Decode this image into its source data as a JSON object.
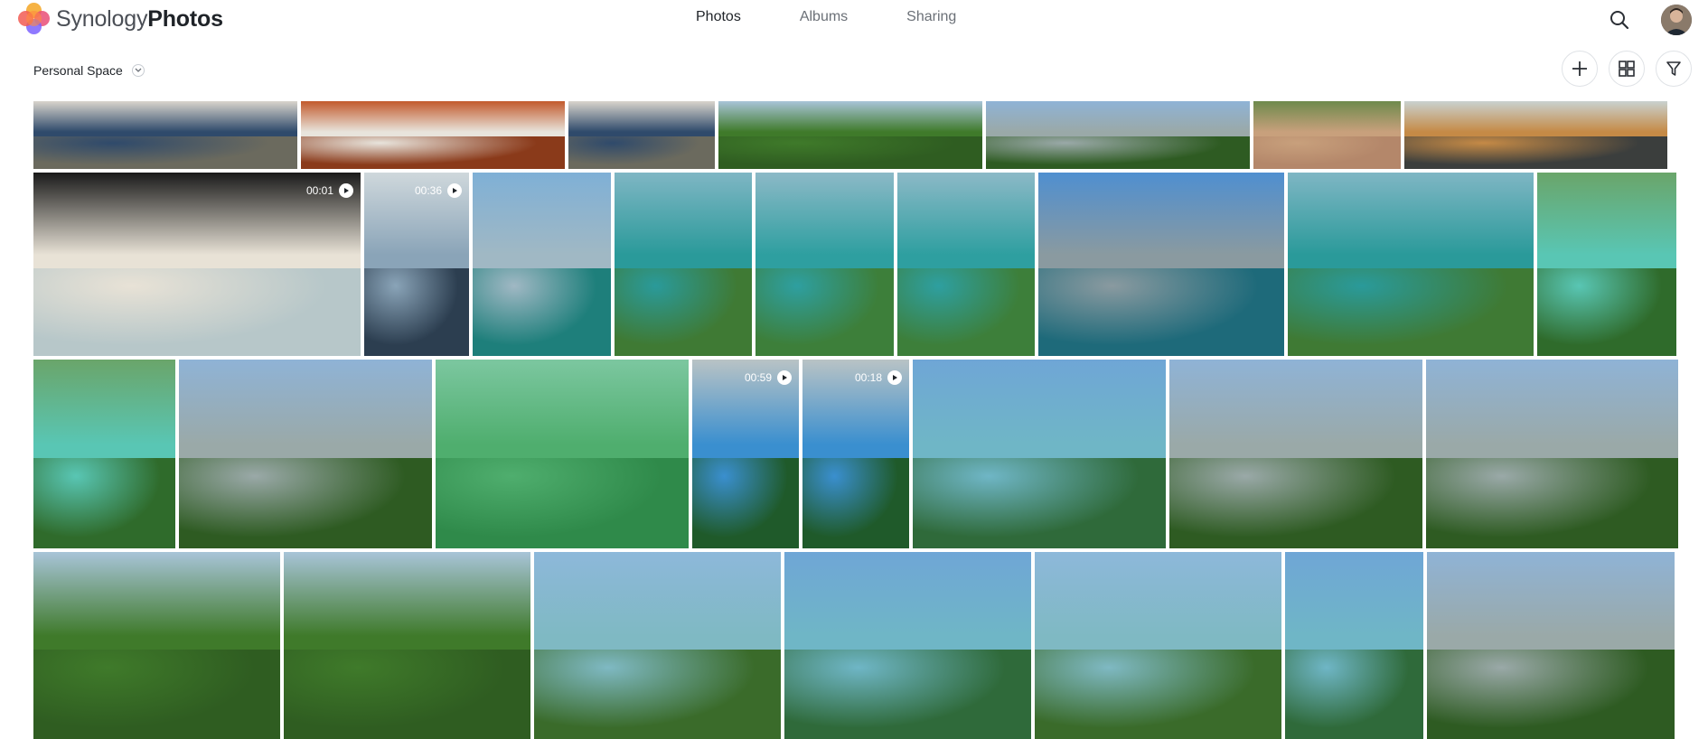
{
  "brand": {
    "light": "Synology",
    "bold": "Photos"
  },
  "nav": {
    "tabs": [
      {
        "label": "Photos",
        "active": true
      },
      {
        "label": "Albums",
        "active": false
      },
      {
        "label": "Sharing",
        "active": false
      }
    ]
  },
  "top_icons": {
    "search": "search-icon",
    "avatar": "user-avatar"
  },
  "space": {
    "label": "Personal Space",
    "icon": "chevron-down-icon"
  },
  "toolbar": {
    "icons": [
      "plus-icon",
      "grid-view-icon",
      "filter-icon"
    ]
  },
  "colors": {
    "accent_text": "#1f2328",
    "muted_text": "#6b7077",
    "border": "#dfe2e6"
  },
  "rows": [
    {
      "photos": [
        {
          "kind": "indoor"
        },
        {
          "kind": "indoor-red"
        },
        {
          "kind": "indoor"
        },
        {
          "kind": "forest"
        },
        {
          "kind": "forest-city"
        },
        {
          "kind": "rooftop"
        },
        {
          "kind": "window-hats"
        }
      ]
    },
    {
      "photos": [
        {
          "kind": "map-sign",
          "duration": "00:01"
        },
        {
          "kind": "ticket-machine",
          "duration": "00:36"
        },
        {
          "kind": "sea-city"
        },
        {
          "kind": "resort-aerial"
        },
        {
          "kind": "island-aerial"
        },
        {
          "kind": "island-aerial"
        },
        {
          "kind": "harbor"
        },
        {
          "kind": "resort-aerial"
        },
        {
          "kind": "waterpark"
        }
      ]
    },
    {
      "photos": [
        {
          "kind": "waterpark"
        },
        {
          "kind": "forest-city"
        },
        {
          "kind": "map-board"
        },
        {
          "kind": "cable-car-interior",
          "duration": "00:59"
        },
        {
          "kind": "cable-car-interior",
          "duration": "00:18"
        },
        {
          "kind": "sea-islands"
        },
        {
          "kind": "forest-city"
        },
        {
          "kind": "forest-city"
        }
      ]
    },
    {
      "photos": [
        {
          "kind": "forest"
        },
        {
          "kind": "forest"
        },
        {
          "kind": "cable-sea"
        },
        {
          "kind": "sea-islands"
        },
        {
          "kind": "cable-sea"
        },
        {
          "kind": "sea-islands"
        },
        {
          "kind": "forest-city"
        }
      ]
    }
  ]
}
